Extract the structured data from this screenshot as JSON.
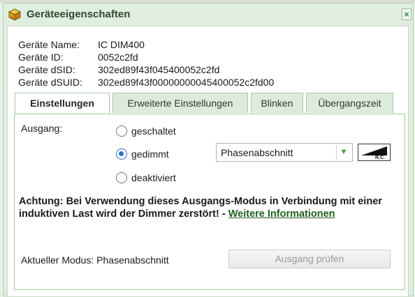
{
  "window": {
    "title": "Geräteeigenschaften",
    "close_label": "×"
  },
  "device_info": [
    {
      "label": "Geräte Name:",
      "value": "IC DIM400"
    },
    {
      "label": "Geräte ID:",
      "value": "0052c2fd"
    },
    {
      "label": "Geräte dSID:",
      "value": "302ed89f43f045400052c2fd"
    },
    {
      "label": "Geräte dSUID:",
      "value": "302ed89f43f00000000045400052c2fd00"
    }
  ],
  "tabs": [
    {
      "label": "Einstellungen",
      "active": true
    },
    {
      "label": "Erweiterte Einstellungen",
      "active": false
    },
    {
      "label": "Blinken",
      "active": false
    },
    {
      "label": "Übergangszeit",
      "active": false
    }
  ],
  "output": {
    "label": "Ausgang:",
    "options": [
      {
        "label": "geschaltet",
        "checked": false
      },
      {
        "label": "gedimmt",
        "checked": true
      },
      {
        "label": "deaktiviert",
        "checked": false
      }
    ],
    "dimming_mode": "Phasenabschnitt",
    "dimming_icon_text": "R.C."
  },
  "warning": {
    "text": "Achtung: Bei Verwendung dieses Ausgangs-Modus in Verbindung mit einer induktiven Last wird der Dimmer zerstört! -",
    "link": "Weitere Informationen"
  },
  "current_mode": "Aktueller Modus: Phasenabschnitt",
  "test_button": "Ausgang prüfen",
  "colors": {
    "accent": "#2a74d1",
    "frame": "#dfeede",
    "panel_border": "#9dd09b",
    "link": "#1f5f1f"
  },
  "icons": {
    "title": "device-box-icon",
    "select_arrow": "chevron-down-icon",
    "dim_curve": "rc-dimming-curve-icon"
  }
}
